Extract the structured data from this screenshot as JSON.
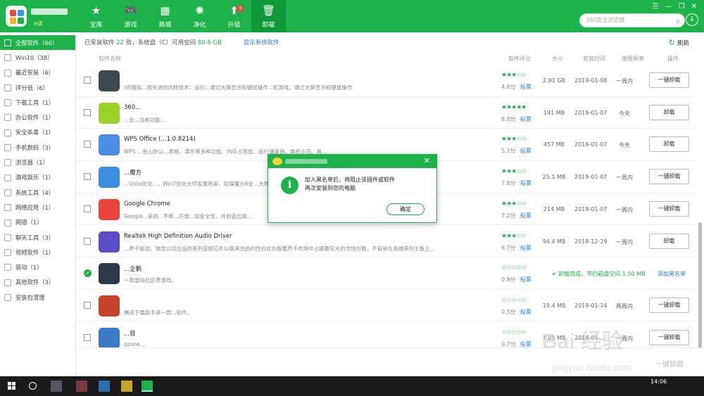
{
  "nav": [
    {
      "label": "宝库",
      "icon": "treasure-icon"
    },
    {
      "label": "游戏",
      "icon": "gamepad-icon"
    },
    {
      "label": "商城",
      "icon": "store-icon"
    },
    {
      "label": "净化",
      "icon": "purify-icon"
    },
    {
      "label": "升级",
      "icon": "upgrade-icon",
      "badge": "3"
    },
    {
      "label": "卸载",
      "icon": "trash-icon",
      "active": true
    }
  ],
  "user": {
    "vip": "e读"
  },
  "search": {
    "placeholder": "360安全浏览器"
  },
  "sidebar": [
    {
      "label": "全部软件（60）",
      "active": true
    },
    {
      "label": "Win10（38）"
    },
    {
      "label": "最近安装（6）"
    },
    {
      "label": "评分低（6）"
    },
    {
      "label": "下载工具（1）"
    },
    {
      "label": "办公软件（1）"
    },
    {
      "label": "安全杀毒（1）"
    },
    {
      "label": "手机数码（3）"
    },
    {
      "label": "浏览器（1）"
    },
    {
      "label": "游戏娱乐（1）"
    },
    {
      "label": "系统工具（4）"
    },
    {
      "label": "网络应用（1）"
    },
    {
      "label": "网银（1）"
    },
    {
      "label": "聊天工具（3）"
    },
    {
      "label": "视频软件（1）"
    },
    {
      "label": "驱动（1）"
    },
    {
      "label": "其他软件（3）"
    },
    {
      "label": "安装包清理"
    }
  ],
  "info": {
    "prefix": "已安装软件",
    "count": "22",
    "mid": "款，系统盘（C）可用空间",
    "space": "80.6 GB",
    "sys_link": "显示系统软件",
    "refresh": "刷新"
  },
  "columns": {
    "name": "软件名称",
    "score": "软件评分",
    "size": "大小",
    "date": "安装时间",
    "freq": "使用频率",
    "op": "操作"
  },
  "rows": [
    {
      "name": "",
      "desc": "(伴随拟...用先进的内核技术，运行...通过大屏显示和键鼠操作...机游戏。通过大屏显示和键鼠操作",
      "stars": "★★★☆☆",
      "score": "4.8分",
      "vote": "投票",
      "size": "2.91 GB",
      "date": "2019-01-08",
      "freq": "一周内",
      "btn": "一键卸载",
      "icon": "#3a4a55"
    },
    {
      "name": "360...",
      "desc": "...全...当前功能...",
      "stars": "★★★★★",
      "score": "8.8分",
      "vote": "投票",
      "size": "191 MB",
      "date": "2019-01-07",
      "freq": "今天",
      "btn": "卸载",
      "icon": "#9bd12a"
    },
    {
      "name": "WPS Office (...1.0.8214)",
      "desc": "WPS ...金山办公...表格、演示等多种功能。内存占用低，运行速度快，体积小巧。具...",
      "stars": "★★★☆☆",
      "score": "5.1分",
      "vote": "投票",
      "size": "457 MB",
      "date": "2019-01-07",
      "freq": "今天",
      "btn": "卸载",
      "icon": "#4a8de6"
    },
    {
      "name": "...魔方",
      "desc": "...Vista优化...，Win7优化大师发展而来，软媒魔方6全...大师发展为一款最好...",
      "stars": "★★★☆☆",
      "score": "7.8分",
      "vote": "投票",
      "size": "25.1 MB",
      "date": "2019-01-07",
      "freq": "一周内",
      "btn": "一键卸载",
      "icon": "#3b8de0"
    },
    {
      "name": "Google Chrome",
      "desc": "Google...采用...不断...开放...如安全性，并创造出简...",
      "stars": "★★★☆☆",
      "score": "7.2分",
      "vote": "投票",
      "size": "214 MB",
      "date": "2019-01-07",
      "freq": "一周内",
      "btn": "一键卸载",
      "icon": "#e8453c"
    },
    {
      "name": "Realtek High Definition Audio Driver",
      "desc": "...声卡驱动。瑞昱公司出品的系列音频芯片以极其出色的性价比在板载声卡市场中占据着较大的市场份额，不管是在高端系列主板上...",
      "stars": "★★★☆☆",
      "score": "6.7分",
      "vote": "投票",
      "size": "94.4 MB",
      "date": "2018-12-29",
      "freq": "一周内",
      "btn": "卸载",
      "icon": "#5b4fc9"
    },
    {
      "name": "...企鹅",
      "desc": "一款虚拟社区养游戏。",
      "stars": "☆☆☆☆☆",
      "score": "0.9分",
      "vote": "投票",
      "done": "卸载完成，节约磁盘空间 1.50 MB",
      "blacklist": "添加黑名单",
      "checked": true,
      "icon": "#2b3a48"
    },
    {
      "name": "",
      "desc": "腾讯下载助手是一款...软件。",
      "stars": "☆☆☆☆☆",
      "score": "0.5分",
      "vote": "投票",
      "size": "19.4 MB",
      "date": "2019-01-14",
      "freq": "两周内",
      "btn": "一键卸载",
      "icon": "#c6432a"
    },
    {
      "name": "...目",
      "desc": "qzone...",
      "stars": "☆☆☆☆☆",
      "score": "0.7分",
      "vote": "投票",
      "size": "7.05 MB",
      "date": "2019-01-...",
      "freq": "一周内",
      "btn": "一键卸载",
      "icon": "#3b7ac8"
    }
  ],
  "bottom": {
    "btn": "一键卸载"
  },
  "dialog": {
    "line1": "加入黑名单后，将阻止该插件或软件",
    "line2": "再次安装到您的电脑",
    "ok": "确定"
  },
  "taskbar": {
    "time": "14:06"
  },
  "watermark": {
    "brand": "Bai 经验",
    "url": "jingyan.baidu.com"
  }
}
